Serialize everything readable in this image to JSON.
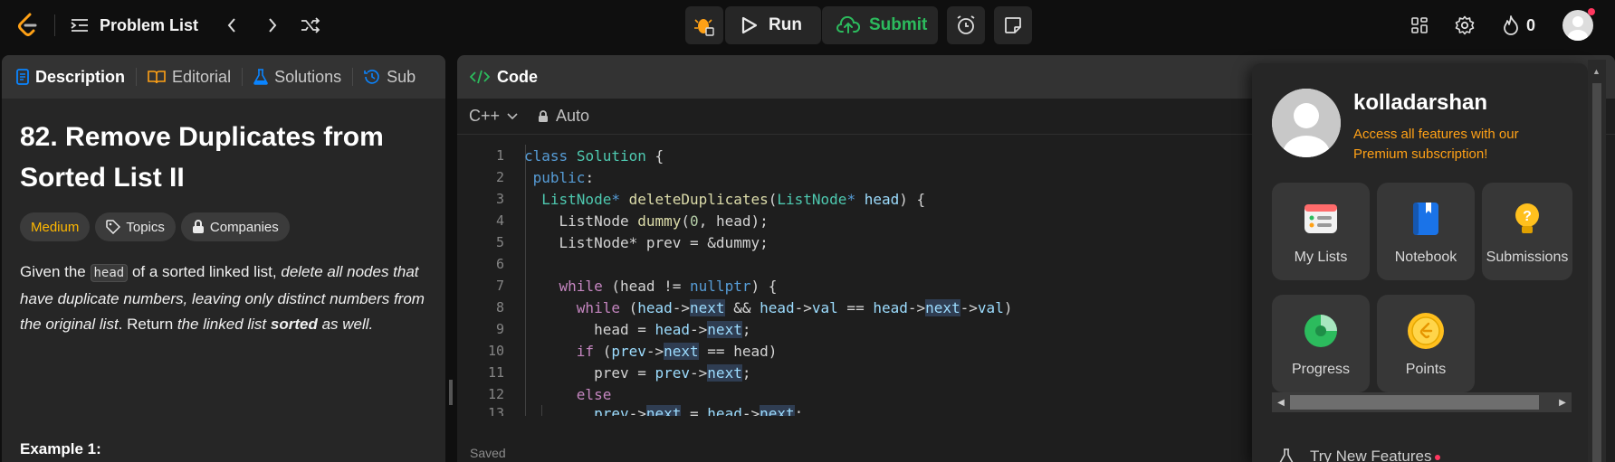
{
  "topbar": {
    "problem_list": "Problem List",
    "run": "Run",
    "submit": "Submit",
    "streak_count": "0"
  },
  "tabs": [
    {
      "label": "Description",
      "icon": "description-icon"
    },
    {
      "label": "Editorial",
      "icon": "book-icon"
    },
    {
      "label": "Solutions",
      "icon": "flask-icon"
    },
    {
      "label": "Sub",
      "icon": "history-icon"
    }
  ],
  "problem": {
    "title": "82. Remove Duplicates from Sorted List II",
    "difficulty": "Medium",
    "topics": "Topics",
    "companies": "Companies",
    "desc_p1": "Given the ",
    "desc_code": "head",
    "desc_p2": " of a sorted linked list, ",
    "desc_italic1": "delete all nodes that have duplicate numbers, leaving only distinct numbers from the original list",
    "desc_p3": ". Return ",
    "desc_italic2": "the linked list ",
    "desc_bold": "sorted",
    "desc_italic3": " as well.",
    "example_heading": "Example 1:"
  },
  "code": {
    "header": "Code",
    "language": "C++",
    "mode": "Auto",
    "status": "Saved",
    "line_numbers": [
      "1",
      "2",
      "3",
      "4",
      "5",
      "6",
      "7",
      "8",
      "9",
      "10",
      "11",
      "12",
      "13"
    ]
  },
  "dropdown": {
    "username": "kolladarshan",
    "premium_text": "Access all features with our Premium subscription!",
    "tiles": [
      {
        "label": "My Lists",
        "icon": "list-icon"
      },
      {
        "label": "Notebook",
        "icon": "notebook-icon"
      },
      {
        "label": "Submissions",
        "icon": "lightbulb-icon"
      },
      {
        "label": "Progress",
        "icon": "pie-chart-icon"
      },
      {
        "label": "Points",
        "icon": "coin-icon"
      }
    ],
    "try_new": "Try New Features"
  }
}
